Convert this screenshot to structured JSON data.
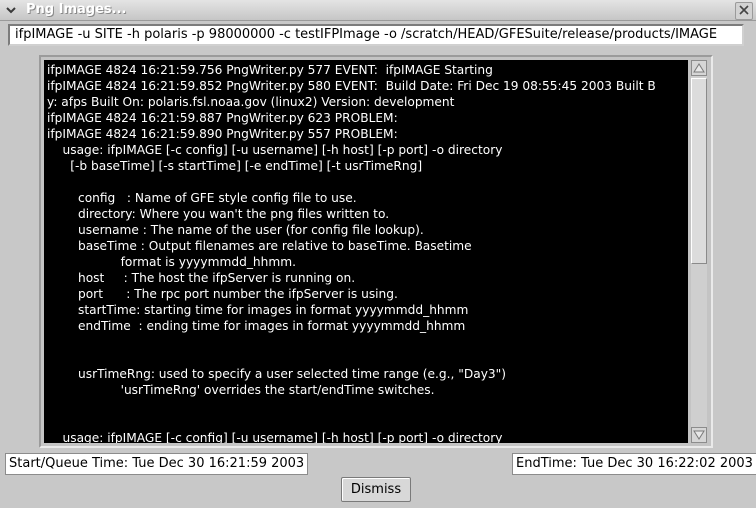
{
  "window": {
    "title": "Png Images..."
  },
  "command": {
    "value": "ifpIMAGE -u SITE -h polaris -p 98000000 -c testIFPImage -o /scratch/HEAD/GFESuite/release/products/IMAGE"
  },
  "log": {
    "text": "ifpIMAGE 4824 16:21:59.756 PngWriter.py 577 EVENT:  ifpIMAGE Starting\nifpIMAGE 4824 16:21:59.852 PngWriter.py 580 EVENT:  Build Date: Fri Dec 19 08:55:45 2003 Built B\ny: afps Built On: polaris.fsl.noaa.gov (linux2) Version: development\nifpIMAGE 4824 16:21:59.887 PngWriter.py 623 PROBLEM:\nifpIMAGE 4824 16:21:59.890 PngWriter.py 557 PROBLEM:\n    usage: ifpIMAGE [-c config] [-u username] [-h host] [-p port] -o directory\n      [-b baseTime] [-s startTime] [-e endTime] [-t usrTimeRng]\n\n        config   : Name of GFE style config file to use.\n        directory: Where you wan't the png files written to.\n        username : The name of the user (for config file lookup).\n        baseTime : Output filenames are relative to baseTime. Basetime\n                   format is yyyymmdd_hhmm.\n        host     : The host the ifpServer is running on.\n        port      : The rpc port number the ifpServer is using.\n        startTime: starting time for images in format yyyymmdd_hhmm\n        endTime  : ending time for images in format yyyymmdd_hhmm\n\n\n        usrTimeRng: used to specify a user selected time range (e.g., \"Day3\")\n                   'usrTimeRng' overrides the start/endTime switches.\n\n\n    usage: ifpIMAGE [-c config] [-u username] [-h host] [-p port] -o directory"
  },
  "status": {
    "start_time": "Start/Queue Time: Tue Dec 30 16:21:59 2003",
    "end_time": "EndTime: Tue Dec 30 16:22:02 2003"
  },
  "buttons": {
    "dismiss": "Dismiss"
  },
  "icons": {
    "window_menu": "chevron-down-icon",
    "close": "close-icon",
    "scroll_up": "arrow-up-icon",
    "scroll_down": "arrow-down-icon"
  }
}
